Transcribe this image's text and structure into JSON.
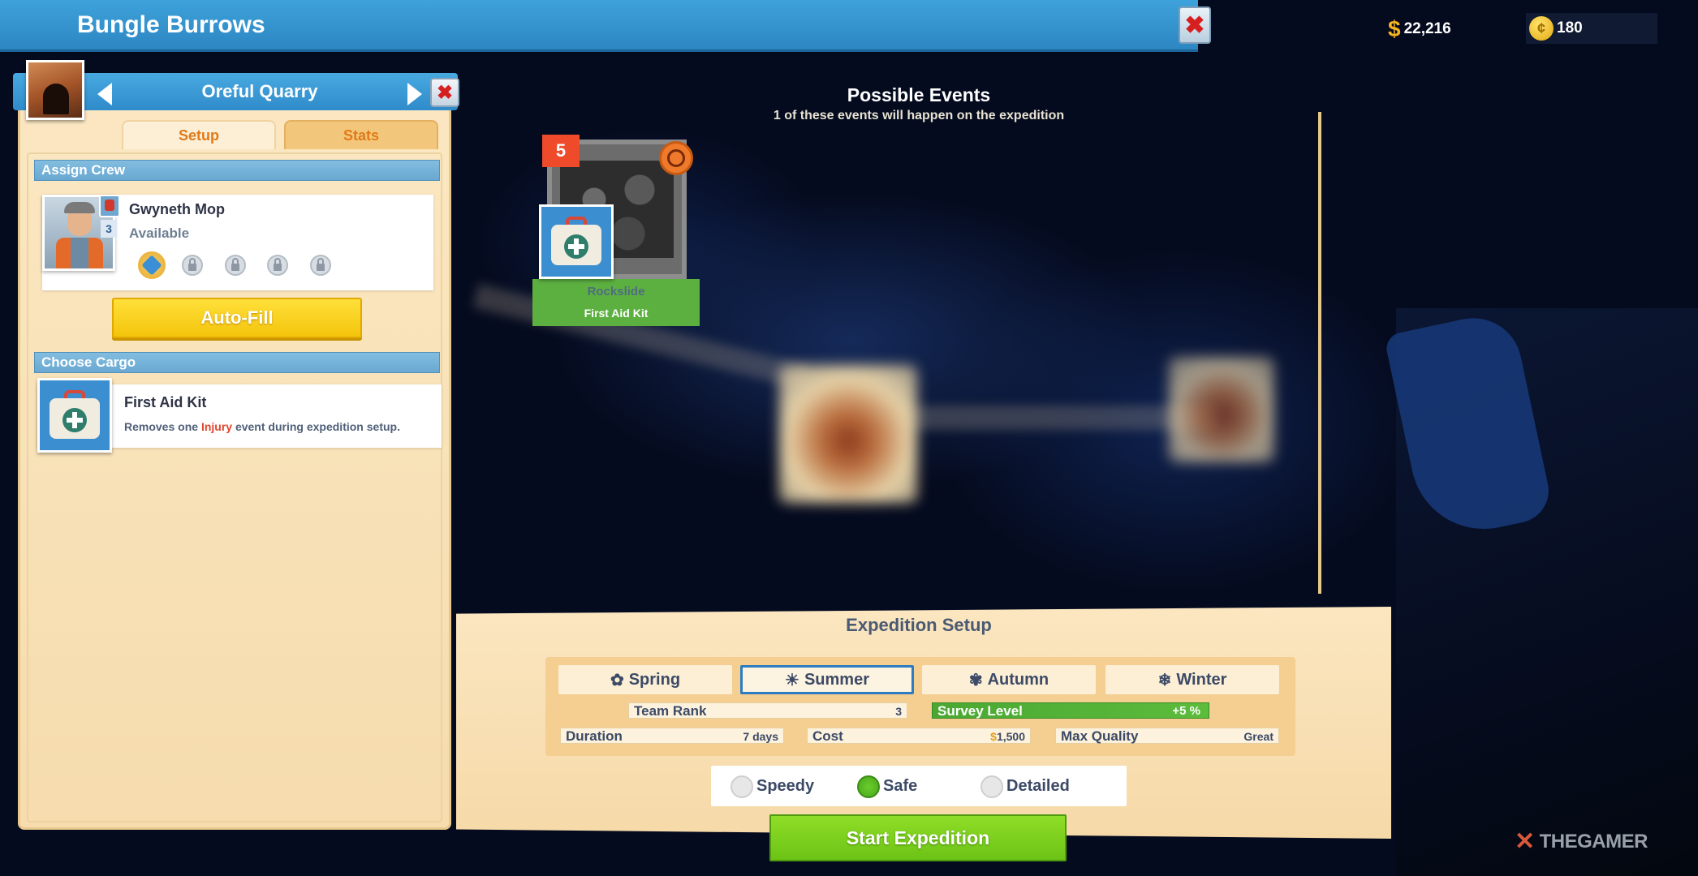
{
  "header": {
    "title": "Bungle Burrows",
    "close_glyph": "✖",
    "money": "22,216",
    "money_symbol": "$",
    "gold": "180",
    "gold_symbol": "¢"
  },
  "location": {
    "name": "Oreful Quarry",
    "close_glyph": "✖",
    "tabs": [
      "Setup",
      "Stats"
    ],
    "active_tab": "Setup"
  },
  "crew": {
    "section_title": "Assign Crew",
    "members": [
      {
        "name": "Gwyneth Mop",
        "status": "Available",
        "rank": "3"
      }
    ],
    "autofill_label": "Auto-Fill"
  },
  "cargo": {
    "section_title": "Choose Cargo",
    "items": [
      {
        "name": "First Aid Kit",
        "desc_before": "Removes one ",
        "desc_highlight": "Injury",
        "desc_after": " event during expedition setup."
      }
    ]
  },
  "events": {
    "title": "Possible Events",
    "subtitle": "1 of these events will happen on the expedition",
    "cards": [
      {
        "count": "5",
        "name": "Rockslide",
        "cargo_label": "First Aid Kit"
      }
    ]
  },
  "setup": {
    "title": "Expedition Setup",
    "seasons": [
      {
        "label": "Spring",
        "icon": "✿"
      },
      {
        "label": "Summer",
        "icon": "☀"
      },
      {
        "label": "Autumn",
        "icon": "✾"
      },
      {
        "label": "Winter",
        "icon": "❄"
      }
    ],
    "selected_season": "Summer",
    "team_rank_label": "Team Rank",
    "team_rank": "3",
    "survey_level_label": "Survey Level",
    "survey_level": "+5 %",
    "duration_label": "Duration",
    "duration": "7 days",
    "cost_label": "Cost",
    "cost": "1,500",
    "cost_symbol": "$",
    "max_quality_label": "Max Quality",
    "max_quality": "Great",
    "modes": [
      "Speedy",
      "Safe",
      "Detailed"
    ],
    "selected_mode": "Safe",
    "start_label": "Start Expedition"
  },
  "watermark": {
    "text": "THEGAMER",
    "glyph": "✕"
  },
  "colors": {
    "header_blue": "#3ea2db",
    "panel_cream": "#fbe7c2",
    "accent_orange": "#e07a1a",
    "autofill_yellow": "#ffe03a",
    "start_green": "#8fdd27",
    "event_count_red": "#ef4b2b",
    "injury_red": "#e0452c"
  }
}
